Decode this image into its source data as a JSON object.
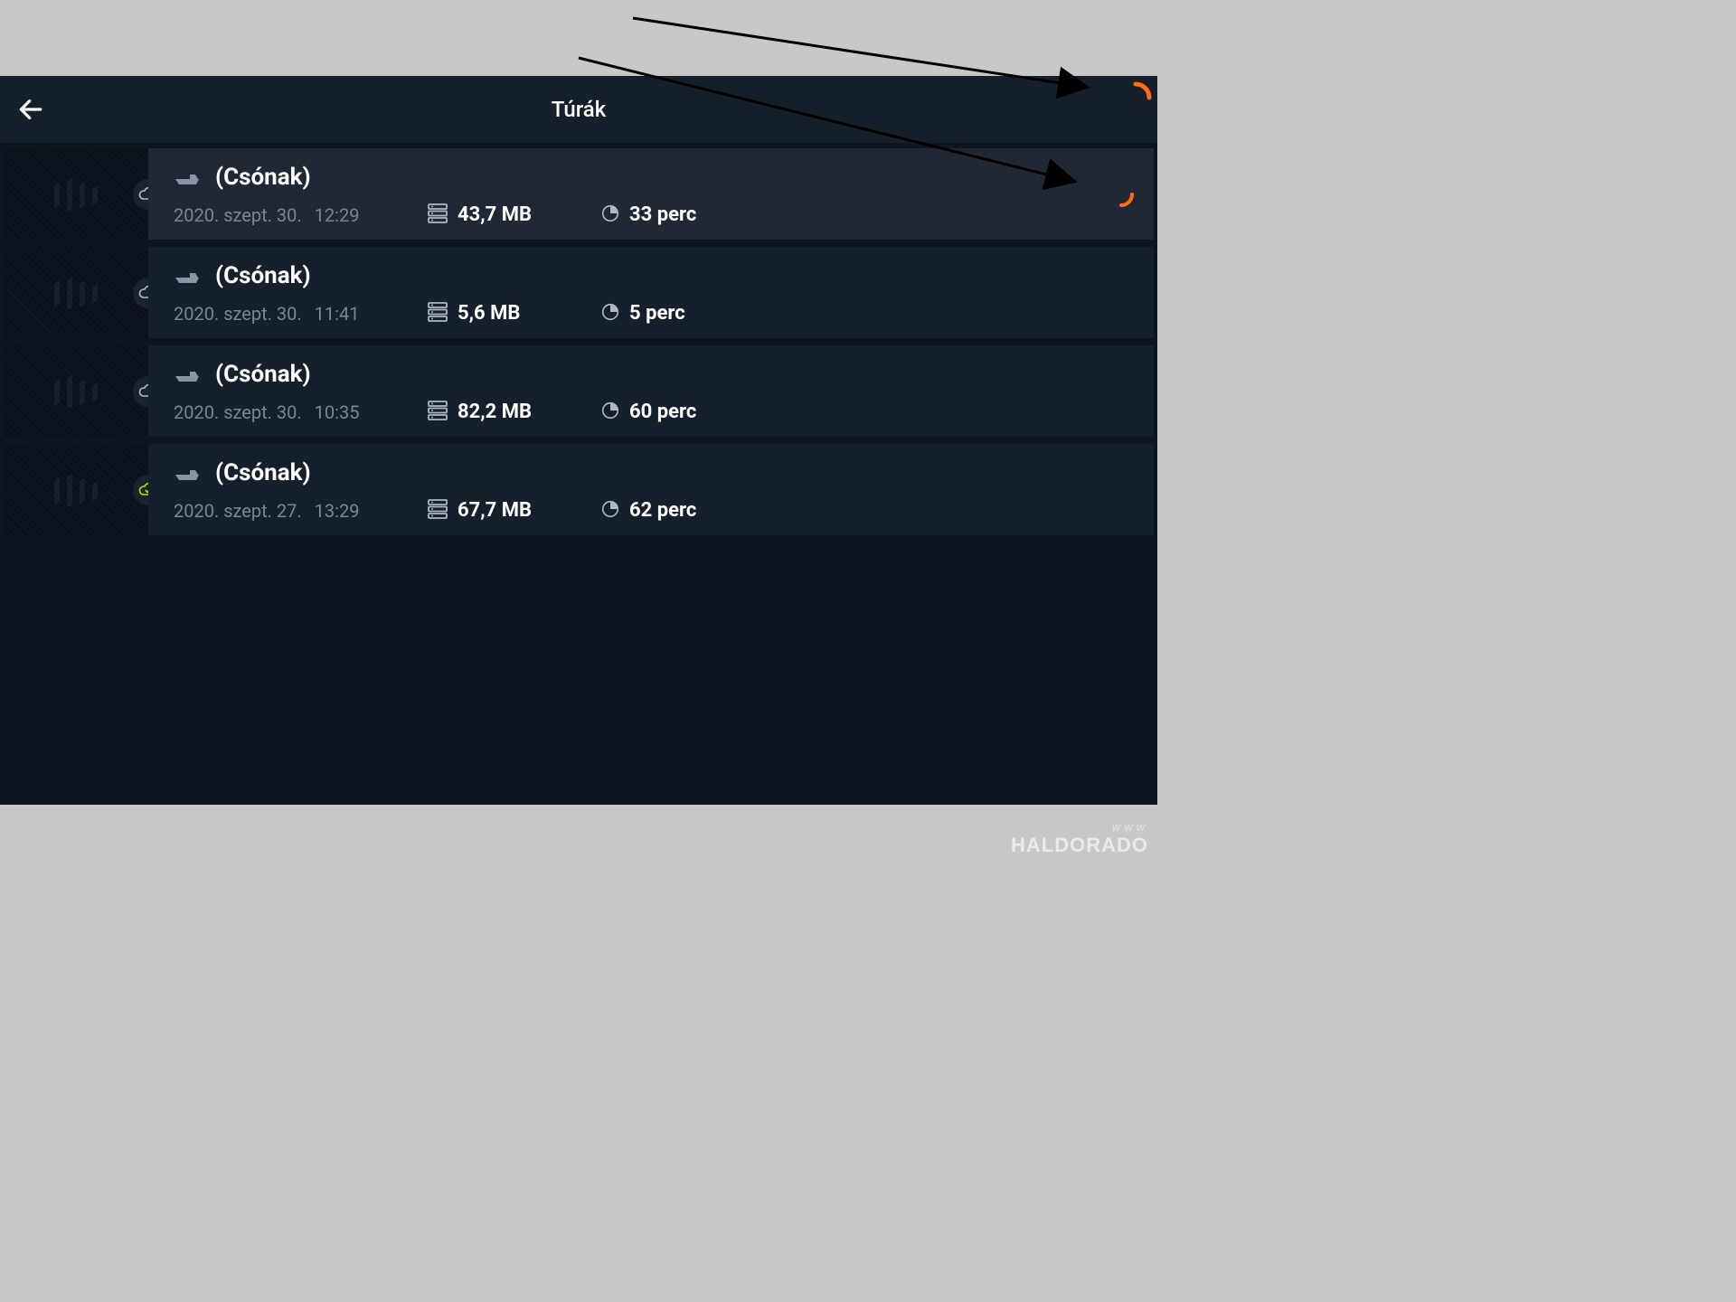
{
  "header": {
    "title": "Túrák"
  },
  "trips": [
    {
      "name": "(Csónak)",
      "date": "2020. szept. 30.",
      "time": "12:29",
      "size": "43,7 MB",
      "duration": "33 perc",
      "synced": false,
      "loading": true,
      "selected": true
    },
    {
      "name": "(Csónak)",
      "date": "2020. szept. 30.",
      "time": "11:41",
      "size": "5,6 MB",
      "duration": "5 perc",
      "synced": false,
      "loading": false,
      "selected": false
    },
    {
      "name": "(Csónak)",
      "date": "2020. szept. 30.",
      "time": "10:35",
      "size": "82,2 MB",
      "duration": "60 perc",
      "synced": false,
      "loading": false,
      "selected": false
    },
    {
      "name": "(Csónak)",
      "date": "2020. szept. 27.",
      "time": "13:29",
      "size": "67,7 MB",
      "duration": "62 perc",
      "synced": true,
      "loading": false,
      "selected": false
    }
  ],
  "colors": {
    "accent": "#ff6a13",
    "success": "#a4e400"
  },
  "watermark": {
    "line1": "WWW",
    "line2": "HALDORADO"
  }
}
